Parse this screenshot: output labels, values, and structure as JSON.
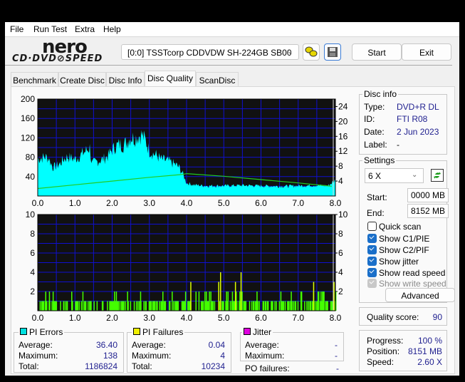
{
  "menu": [
    "File",
    "Run Test",
    "Extra",
    "Help"
  ],
  "logo": {
    "line1": "nero",
    "line2": "CD·DVD⊘SPEED"
  },
  "drive_select": {
    "value": "[0:0]   TSSTcorp CDDVDW SH-224GB SB00"
  },
  "toolbar": {
    "start_label": "Start",
    "exit_label": "Exit"
  },
  "tabs": [
    {
      "label": "Benchmark",
      "active": false
    },
    {
      "label": "Create Disc",
      "active": false
    },
    {
      "label": "Disc Info",
      "active": false
    },
    {
      "label": "Disc Quality",
      "active": true
    },
    {
      "label": "ScanDisc",
      "active": false
    }
  ],
  "disc_info": {
    "title": "Disc info",
    "rows": [
      {
        "label": "Type:",
        "value": "DVD+R DL"
      },
      {
        "label": "ID:",
        "value": "FTI R08"
      },
      {
        "label": "Date:",
        "value": "2 Jun 2023"
      },
      {
        "label": "Label:",
        "value": "-"
      }
    ]
  },
  "settings": {
    "title": "Settings",
    "speed": "6 X",
    "start_label": "Start:",
    "start_value": "0000 MB",
    "end_label": "End:",
    "end_value": "8152 MB",
    "checkboxes": [
      {
        "label": "Quick scan",
        "checked": false,
        "enabled": true
      },
      {
        "label": "Show C1/PIE",
        "checked": true,
        "enabled": true
      },
      {
        "label": "Show C2/PIF",
        "checked": true,
        "enabled": true
      },
      {
        "label": "Show jitter",
        "checked": true,
        "enabled": true
      },
      {
        "label": "Show read speed",
        "checked": true,
        "enabled": true
      },
      {
        "label": "Show write speed",
        "checked": true,
        "enabled": false
      }
    ],
    "advanced_label": "Advanced"
  },
  "quality": {
    "label": "Quality score:",
    "value": "90"
  },
  "progress": {
    "rows": [
      {
        "label": "Progress:",
        "value": "100 %"
      },
      {
        "label": "Position:",
        "value": "8151 MB"
      },
      {
        "label": "Speed:",
        "value": "2.60 X"
      }
    ]
  },
  "stats": {
    "pi_errors": {
      "title": "PI Errors",
      "color": "#00e0e0",
      "average_label": "Average:",
      "average": "36.40",
      "maximum_label": "Maximum:",
      "maximum": "138",
      "total_label": "Total:",
      "total": "1186824"
    },
    "pi_failures": {
      "title": "PI Failures",
      "color": "#f0f000",
      "average_label": "Average:",
      "average": "0.04",
      "maximum_label": "Maximum:",
      "maximum": "4",
      "total_label": "Total:",
      "total": "10234"
    },
    "jitter": {
      "title": "Jitter",
      "color": "#e000e0",
      "average_label": "Average:",
      "average": "-",
      "maximum_label": "Maximum:",
      "maximum": "-"
    },
    "po_failures": {
      "label": "PO failures:",
      "value": "-"
    }
  },
  "colors": {
    "plot_bg": "#111111",
    "grid": "#1010d0",
    "pie": "#00ffff",
    "pif": "#44ff00",
    "pif_high": "#ddff00",
    "speed": "#22cc22"
  },
  "chart_data": [
    {
      "type": "area",
      "title": "PI Errors",
      "xlabel": "",
      "ylabel": "",
      "xlim": [
        0,
        8.0
      ],
      "ylim": [
        0,
        200
      ],
      "y2lim": [
        0,
        26
      ],
      "x_ticks": [
        "0.0",
        "1.0",
        "2.0",
        "3.0",
        "4.0",
        "5.0",
        "6.0",
        "7.0",
        "8.0"
      ],
      "y_ticks": [
        "40",
        "80",
        "120",
        "160",
        "200"
      ],
      "y2_ticks": [
        "4",
        "8",
        "12",
        "16",
        "20",
        "24"
      ],
      "grid": true,
      "series": [
        {
          "name": "PI Errors",
          "x": [
            0.0,
            0.2,
            0.3,
            0.4,
            0.5,
            0.6,
            0.7,
            0.8,
            0.9,
            1.0,
            1.1,
            1.2,
            1.3,
            1.4,
            1.45,
            1.5,
            1.6,
            1.7,
            1.8,
            1.9,
            2.0,
            2.1,
            2.2,
            2.3,
            2.4,
            2.5,
            2.6,
            2.7,
            2.8,
            2.9,
            3.0,
            3.1,
            3.2,
            3.3,
            3.4,
            3.5,
            3.6,
            3.7,
            3.8,
            3.9,
            4.0,
            4.2,
            4.5,
            5.0,
            5.5,
            6.0,
            6.5,
            7.0,
            7.5,
            7.8,
            7.9,
            8.0
          ],
          "values": [
            80,
            85,
            82,
            62,
            65,
            70,
            80,
            85,
            82,
            80,
            85,
            92,
            98,
            105,
            70,
            72,
            75,
            78,
            82,
            88,
            100,
            108,
            112,
            110,
            118,
            128,
            125,
            130,
            133,
            120,
            98,
            92,
            88,
            80,
            78,
            76,
            72,
            68,
            62,
            48,
            28,
            24,
            22,
            22,
            23,
            22,
            21,
            22,
            23,
            22,
            28,
            35
          ]
        },
        {
          "name": "Read Speed",
          "axis": "y2",
          "x": [
            0.0,
            1.0,
            2.0,
            3.0,
            3.9,
            4.0,
            5.0,
            6.0,
            7.0,
            7.9
          ],
          "values": [
            2.0,
            3.0,
            4.0,
            5.0,
            5.8,
            6.0,
            5.3,
            4.4,
            3.5,
            2.6
          ]
        }
      ]
    },
    {
      "type": "bar",
      "title": "PI Failures",
      "xlim": [
        0,
        8.0
      ],
      "ylim": [
        0,
        10
      ],
      "y2lim": [
        0,
        10
      ],
      "x_ticks": [
        "0.0",
        "1.0",
        "2.0",
        "3.0",
        "4.0",
        "5.0",
        "6.0",
        "7.0",
        "8.0"
      ],
      "y_ticks": [
        "2",
        "4",
        "6",
        "8",
        "10"
      ],
      "y2_ticks": [
        "2",
        "4",
        "6",
        "8",
        "10"
      ],
      "grid": true,
      "series": [
        {
          "name": "PI Failures",
          "peaks": [
            {
              "x": 0.2,
              "v": 2
            },
            {
              "x": 0.3,
              "v": 2
            },
            {
              "x": 0.4,
              "v": 2
            },
            {
              "x": 0.9,
              "v": 2
            },
            {
              "x": 1.2,
              "v": 2
            },
            {
              "x": 2.05,
              "v": 2
            },
            {
              "x": 2.1,
              "v": 2
            },
            {
              "x": 2.4,
              "v": 2
            },
            {
              "x": 2.75,
              "v": 2
            },
            {
              "x": 3.35,
              "v": 2
            },
            {
              "x": 3.6,
              "v": 2
            },
            {
              "x": 4.1,
              "v": 3
            },
            {
              "x": 4.85,
              "v": 3
            },
            {
              "x": 4.9,
              "v": 4
            },
            {
              "x": 5.3,
              "v": 3
            },
            {
              "x": 5.45,
              "v": 4
            },
            {
              "x": 7.4,
              "v": 3
            },
            {
              "x": 7.95,
              "v": 3
            }
          ],
          "baseline_segments": [
            [
              0.05,
              0.5
            ],
            [
              0.6,
              1.6
            ],
            [
              1.7,
              3.9
            ],
            [
              3.9,
              8.0
            ]
          ],
          "baseline_value": 1
        }
      ]
    }
  ]
}
